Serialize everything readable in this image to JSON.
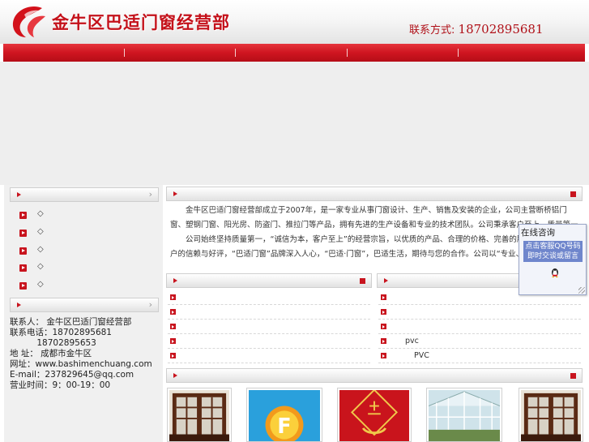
{
  "header": {
    "site_title": "金牛区巴适门窗经营部",
    "contact_label": "联系方式:",
    "contact_phone": "18702895681"
  },
  "colors": {
    "brand_red": "#c8141e",
    "nav_red": "#cf1520",
    "banner_gray": "#eeeeee"
  },
  "nav": {
    "items": [
      "",
      "",
      "",
      "",
      ""
    ]
  },
  "sidebar": {
    "categories_title": "",
    "category_items": [
      "◇",
      "◇",
      "◇",
      "◇",
      "◇"
    ],
    "contact_title": "",
    "contact_lines": [
      "联系人： 金牛区巴适门窗经营部",
      "联系电话：18702895681",
      "          18702895653",
      "地 址： 成都市金牛区",
      "网址：www.bashimenchuang.com",
      "E-mail：237829645@qq.com",
      "营业时间：9：00-19：00"
    ]
  },
  "intro": {
    "title": "",
    "paragraphs": [
      "金牛区巴适门窗经营部成立于2007年，是一家专业从事门窗设计、生产、销售及安装的企业，公司主营断桥铝门窗、塑钢门窗、阳光房、防盗门、推拉门等产品，拥有先进的生产设备和专业的技术团队。公司秉承客户至上、质量第一的经营理念，为广大客户提供优质的产品和周到的服务。",
      "公司始终坚持质量第一，“诚信为本，客户至上”的经营宗旨，以优质的产品、合理的价格、完善的服务赢得了广大客户的信赖与好评，“巴适门窗”品牌深入人心，“巴适·门窗”，巴适生活，期待与您的合作。公司以“专业、诚信、创新、共赢”为发展理念，不断提升产品品质和服务水平，竭诚为社会各界朋友提供更优质的门窗产品和解决方案。"
    ]
  },
  "news": {
    "title": "",
    "items": [
      "",
      "",
      "",
      "",
      ""
    ]
  },
  "knowledge": {
    "title": "",
    "items": [
      "",
      "",
      "",
      "pvc",
      "PVC"
    ]
  },
  "products": {
    "title": "",
    "items": [
      "wood-window-1",
      "f-logo",
      "red-door",
      "sunroom",
      "wood-window-2"
    ]
  },
  "consult": {
    "title": "在线咨询",
    "box_line1": "点击客服QQ号码",
    "box_line2": "即时交谈或留言",
    "icon": "qq-penguin-icon"
  }
}
